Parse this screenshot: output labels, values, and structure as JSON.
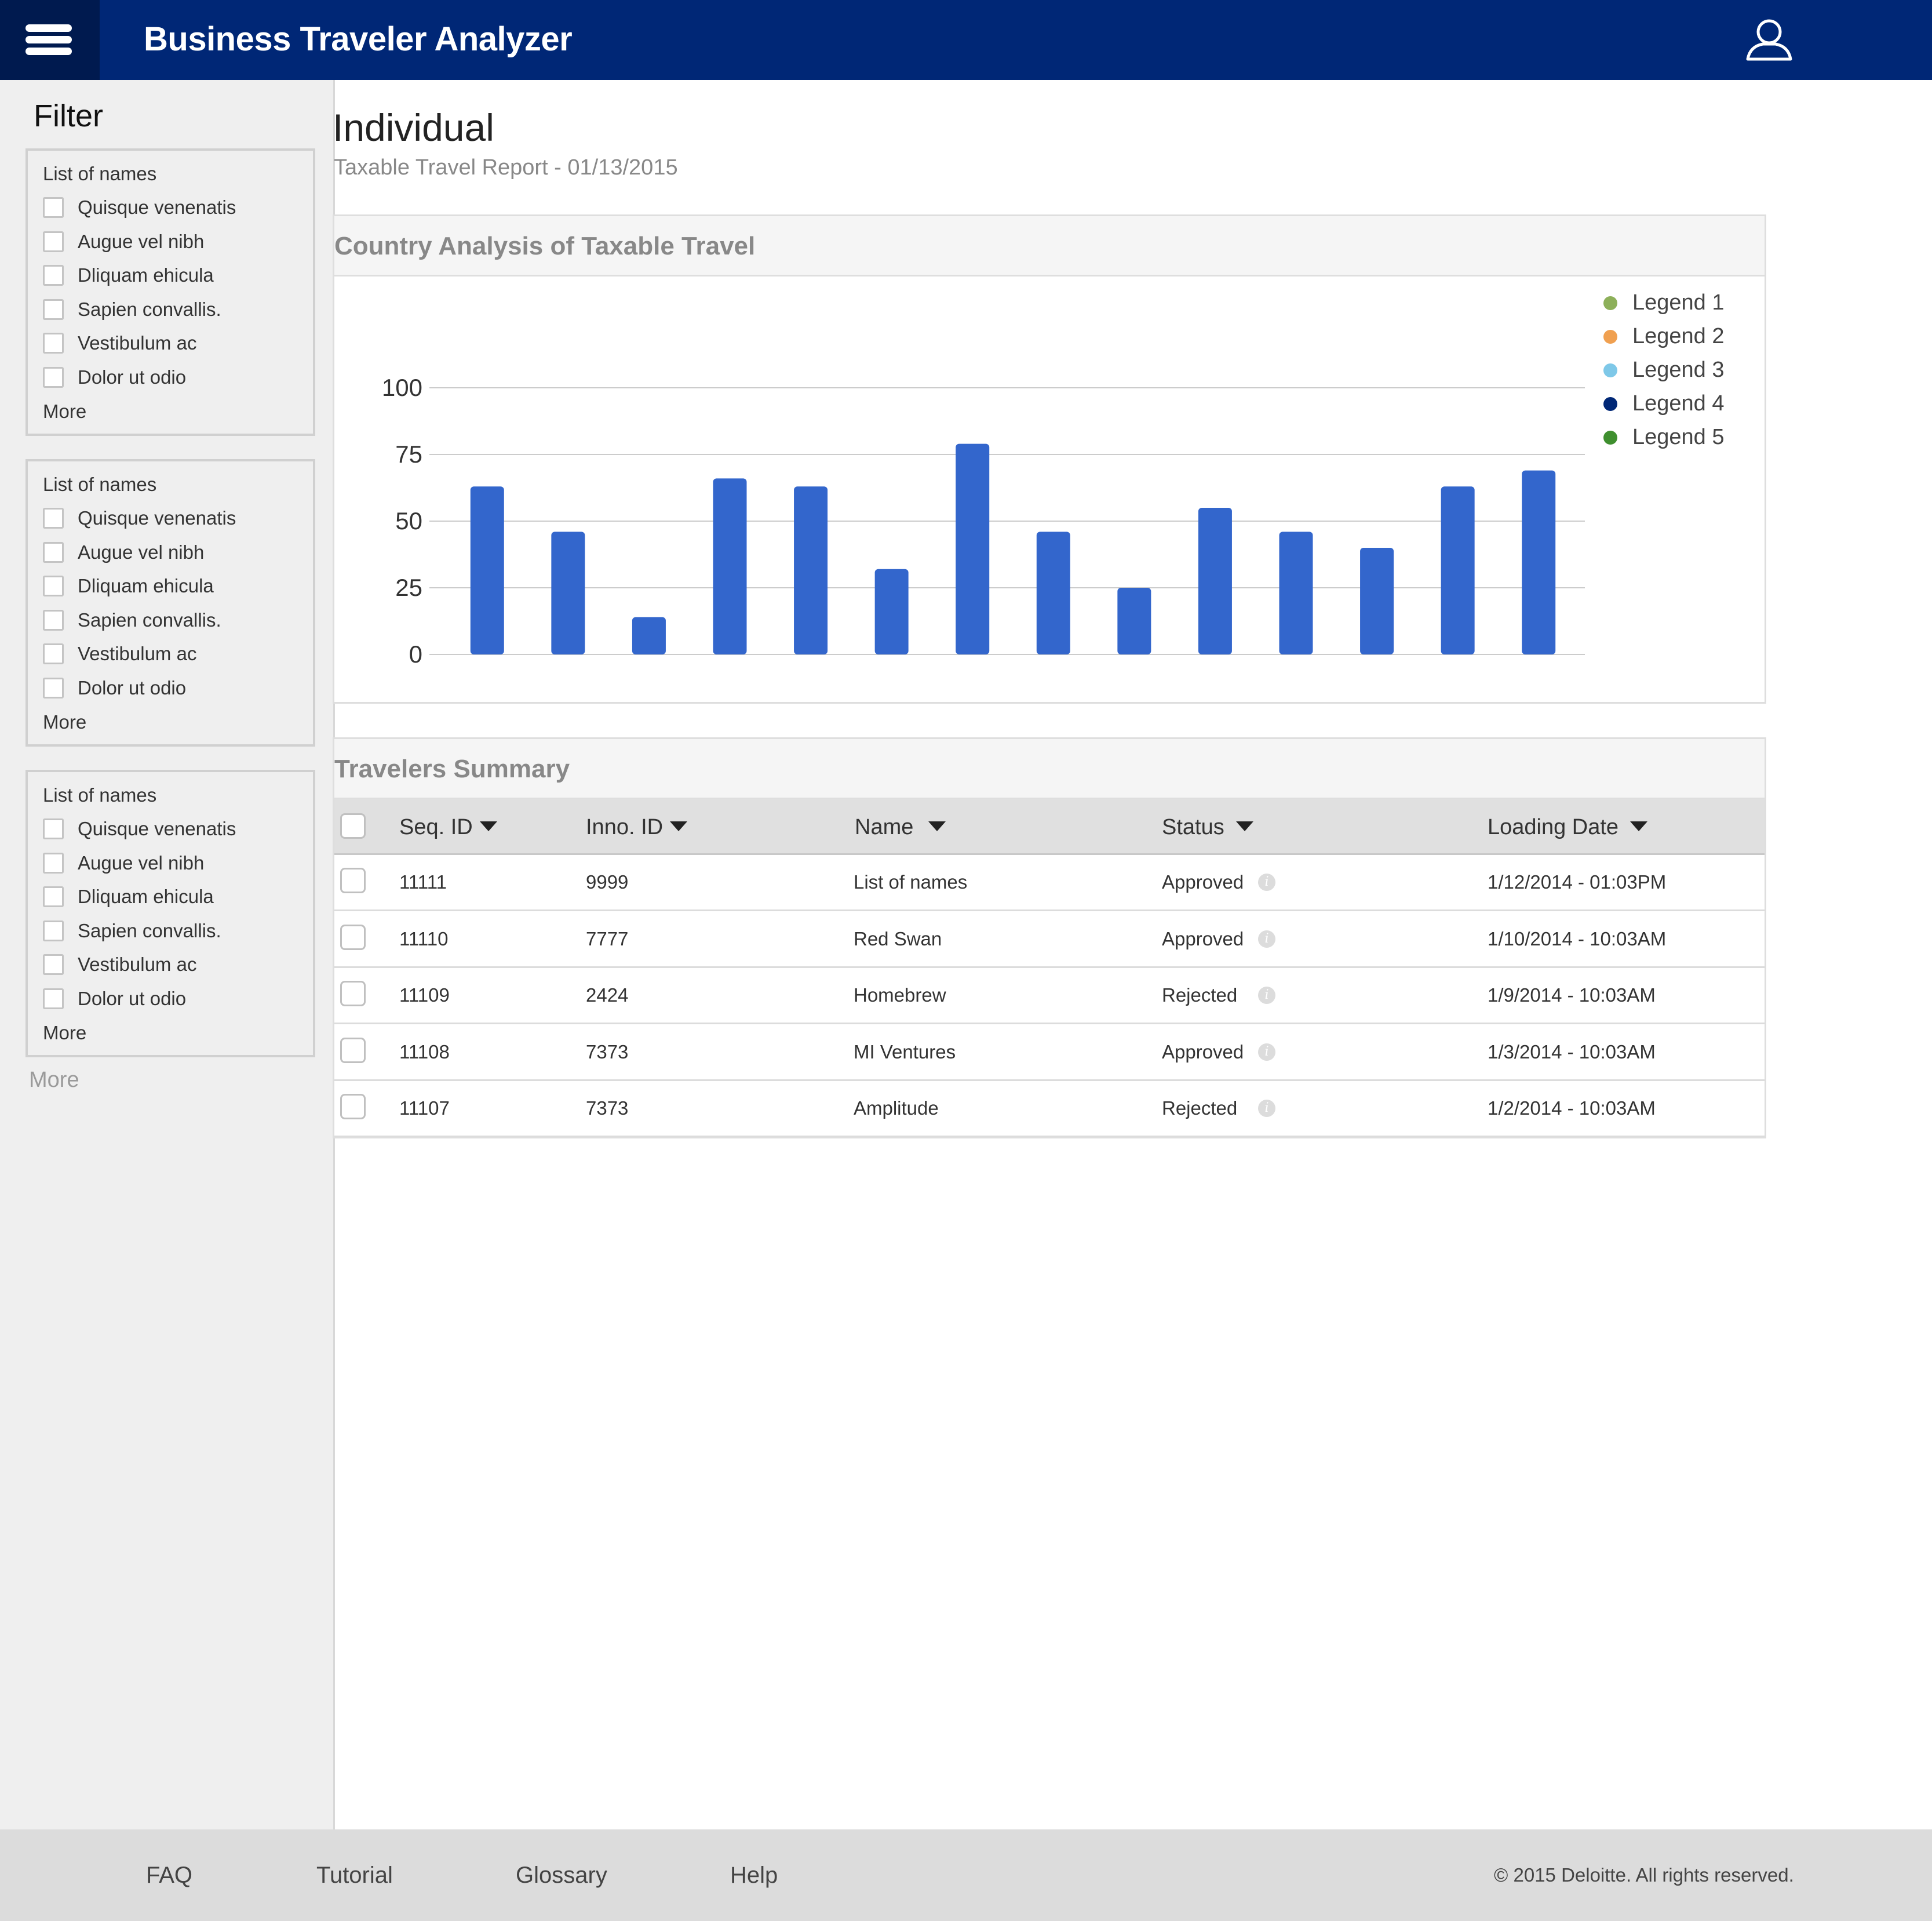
{
  "header": {
    "app_title": "Business Traveler Analyzer"
  },
  "sidebar": {
    "title": "Filter",
    "groups": [
      {
        "title": "List of names",
        "items": [
          "Quisque venenatis",
          "Augue vel nibh",
          "Dliquam  ehicula",
          "Sapien convallis.",
          "Vestibulum ac",
          "Dolor ut odio"
        ],
        "more_label": "More"
      },
      {
        "title": "List of names",
        "items": [
          "Quisque venenatis",
          "Augue vel nibh",
          "Dliquam  ehicula",
          "Sapien convallis.",
          "Vestibulum ac",
          "Dolor ut odio"
        ],
        "more_label": "More"
      },
      {
        "title": "List of names",
        "items": [
          "Quisque venenatis",
          "Augue vel nibh",
          "Dliquam  ehicula",
          "Sapien convallis.",
          "Vestibulum ac",
          "Dolor ut odio"
        ],
        "more_label": "More"
      }
    ],
    "more_label": "More"
  },
  "main": {
    "title": "Individual",
    "subtitle": "Taxable Travel Report - 01/13/2015"
  },
  "chart_panel": {
    "title": "Country Analysis of Taxable Travel"
  },
  "chart_data": {
    "type": "bar",
    "title": "Country Analysis of Taxable Travel",
    "xlabel": "",
    "ylabel": "",
    "categories": [
      "",
      "",
      "",
      "",
      "",
      "",
      "",
      "",
      "",
      "",
      "",
      "",
      "",
      ""
    ],
    "values": [
      63,
      46,
      14,
      66,
      63,
      32,
      79,
      46,
      25,
      55,
      46,
      40,
      63,
      69
    ],
    "ylim": [
      0,
      100
    ],
    "yticks": [
      "0",
      "25",
      "50",
      "75",
      "100"
    ],
    "ytick_values": [
      0,
      25,
      50,
      75,
      100
    ],
    "grid": true,
    "bar_color": "#3366cc",
    "legend": {
      "placement": "top-right",
      "entries": [
        {
          "label": "Legend 1",
          "color": "#8db05a"
        },
        {
          "label": "Legend 2",
          "color": "#f0a050"
        },
        {
          "label": "Legend 3",
          "color": "#7ec8e8"
        },
        {
          "label": "Legend 4",
          "color": "#002776"
        },
        {
          "label": "Legend 5",
          "color": "#3f8f2f"
        }
      ]
    }
  },
  "table": {
    "title": "Travelers Summary",
    "columns": [
      "Seq. ID",
      "Inno. ID",
      "Name",
      "Status",
      "Loading Date"
    ],
    "rows": [
      {
        "seq": "11111",
        "inno": "9999",
        "name": "List of names",
        "status": "Approved",
        "date": "1/12/2014  -  01:03PM"
      },
      {
        "seq": "11110",
        "inno": "7777",
        "name": "Red Swan",
        "status": "Approved",
        "date": "1/10/2014  - 10:03AM"
      },
      {
        "seq": "11109",
        "inno": "2424",
        "name": "Homebrew",
        "status": "Rejected",
        "date": "1/9/2014  - 10:03AM"
      },
      {
        "seq": "11108",
        "inno": "7373",
        "name": "MI Ventures",
        "status": "Approved",
        "date": "1/3/2014  - 10:03AM"
      },
      {
        "seq": "11107",
        "inno": "7373",
        "name": "Amplitude",
        "status": "Rejected",
        "date": "1/2/2014  - 10:03AM"
      }
    ],
    "info_icon_glyph": "i"
  },
  "footer": {
    "links": [
      "FAQ",
      "Tutorial",
      "Glossary",
      "Help"
    ],
    "copyright": "© 2015 Deloitte. All rights reserved."
  },
  "icons": {
    "menu": "hamburger-menu-icon",
    "user": "user-profile-icon",
    "sort": "caret-down-icon",
    "info": "info-icon"
  },
  "colors": {
    "header_bg": "#002776",
    "menu_bg": "#001a4f",
    "sidebar_bg": "#efefef",
    "footer_bg": "#dcdcdc",
    "bar": "#3366cc"
  }
}
